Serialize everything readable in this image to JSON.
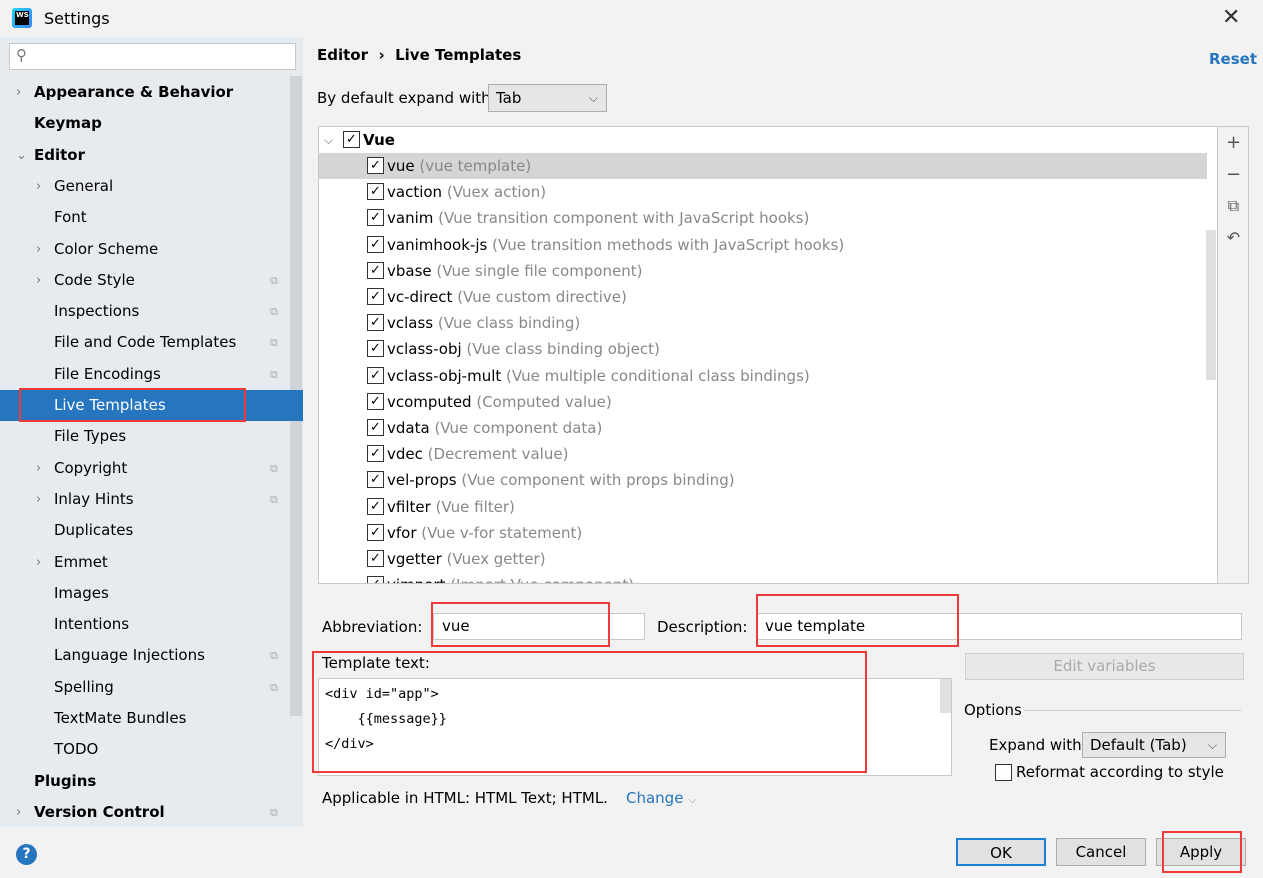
{
  "window": {
    "title": "Settings",
    "close": "✕",
    "logo_text": "WS"
  },
  "search": {
    "placeholder": "",
    "icon": "search-icon"
  },
  "sidebar": {
    "items": [
      {
        "label": "Appearance & Behavior",
        "level": 0,
        "bold": true,
        "arrow": "›",
        "copy": false
      },
      {
        "label": "Keymap",
        "level": 0,
        "bold": true,
        "arrow": "",
        "copy": false
      },
      {
        "label": "Editor",
        "level": 0,
        "bold": true,
        "arrow": "⌄",
        "copy": false
      },
      {
        "label": "General",
        "level": 1,
        "arrow": "›",
        "copy": false
      },
      {
        "label": "Font",
        "level": 1,
        "arrow": "",
        "copy": false
      },
      {
        "label": "Color Scheme",
        "level": 1,
        "arrow": "›",
        "copy": false
      },
      {
        "label": "Code Style",
        "level": 1,
        "arrow": "›",
        "copy": true
      },
      {
        "label": "Inspections",
        "level": 1,
        "arrow": "",
        "copy": true
      },
      {
        "label": "File and Code Templates",
        "level": 1,
        "arrow": "",
        "copy": true
      },
      {
        "label": "File Encodings",
        "level": 1,
        "arrow": "",
        "copy": true
      },
      {
        "label": "Live Templates",
        "level": 1,
        "arrow": "",
        "copy": false,
        "selected": true
      },
      {
        "label": "File Types",
        "level": 1,
        "arrow": "",
        "copy": false
      },
      {
        "label": "Copyright",
        "level": 1,
        "arrow": "›",
        "copy": true
      },
      {
        "label": "Inlay Hints",
        "level": 1,
        "arrow": "›",
        "copy": true
      },
      {
        "label": "Duplicates",
        "level": 1,
        "arrow": "",
        "copy": false
      },
      {
        "label": "Emmet",
        "level": 1,
        "arrow": "›",
        "copy": false
      },
      {
        "label": "Images",
        "level": 1,
        "arrow": "",
        "copy": false
      },
      {
        "label": "Intentions",
        "level": 1,
        "arrow": "",
        "copy": false
      },
      {
        "label": "Language Injections",
        "level": 1,
        "arrow": "",
        "copy": true
      },
      {
        "label": "Spelling",
        "level": 1,
        "arrow": "",
        "copy": true
      },
      {
        "label": "TextMate Bundles",
        "level": 1,
        "arrow": "",
        "copy": false
      },
      {
        "label": "TODO",
        "level": 1,
        "arrow": "",
        "copy": false
      },
      {
        "label": "Plugins",
        "level": 0,
        "bold": true,
        "arrow": "",
        "copy": false
      },
      {
        "label": "Version Control",
        "level": 0,
        "bold": true,
        "arrow": "›",
        "copy": true
      }
    ]
  },
  "header": {
    "breadcrumb_parent": "Editor",
    "breadcrumb_sep": "›",
    "breadcrumb_current": "Live Templates",
    "reset": "Reset"
  },
  "expand_default": {
    "label": "By default expand with",
    "value": "Tab"
  },
  "templates": {
    "group": "Vue",
    "group_checked": true,
    "selected_index": 0,
    "items": [
      {
        "name": "vue",
        "desc": "(vue template)",
        "checked": true
      },
      {
        "name": "vaction",
        "desc": "(Vuex action)",
        "checked": true
      },
      {
        "name": "vanim",
        "desc": "(Vue transition component with JavaScript hooks)",
        "checked": true
      },
      {
        "name": "vanimhook-js",
        "desc": "(Vue transition methods with JavaScript hooks)",
        "checked": true
      },
      {
        "name": "vbase",
        "desc": "(Vue single file component)",
        "checked": true
      },
      {
        "name": "vc-direct",
        "desc": "(Vue custom directive)",
        "checked": true
      },
      {
        "name": "vclass",
        "desc": "(Vue class binding)",
        "checked": true
      },
      {
        "name": "vclass-obj",
        "desc": "(Vue class binding object)",
        "checked": true
      },
      {
        "name": "vclass-obj-mult",
        "desc": "(Vue multiple conditional class bindings)",
        "checked": true
      },
      {
        "name": "vcomputed",
        "desc": "(Computed value)",
        "checked": true
      },
      {
        "name": "vdata",
        "desc": "(Vue component data)",
        "checked": true
      },
      {
        "name": "vdec",
        "desc": "(Decrement value)",
        "checked": true
      },
      {
        "name": "vel-props",
        "desc": "(Vue component with props binding)",
        "checked": true
      },
      {
        "name": "vfilter",
        "desc": "(Vue filter)",
        "checked": true
      },
      {
        "name": "vfor",
        "desc": "(Vue v-for statement)",
        "checked": true
      },
      {
        "name": "vgetter",
        "desc": "(Vuex getter)",
        "checked": true
      },
      {
        "name": "vimport",
        "desc": "(Import Vue component)",
        "checked": true
      }
    ]
  },
  "tools": {
    "add": "+",
    "remove": "−",
    "copy": "⧉",
    "revert": "↶"
  },
  "editor": {
    "abbreviation_label": "Abbreviation:",
    "abbreviation_value": "vue",
    "description_label": "Description:",
    "description_value": "vue template",
    "template_label": "Template text:",
    "template_lines": [
      "<div id=\"app\">",
      "    {{message}}",
      "</div>"
    ],
    "edit_variables": "Edit variables",
    "options_label": "Options",
    "expand_with_label": "Expand with",
    "expand_with_value": "Default (Tab)",
    "reformat_label": "Reformat according to style",
    "reformat_checked": false,
    "applicable": "Applicable in HTML: HTML Text; HTML.",
    "change": "Change"
  },
  "footer": {
    "help": "?",
    "ok": "OK",
    "cancel": "Cancel",
    "apply": "Apply"
  },
  "colors": {
    "accent": "#2675bf",
    "highlight_box": "#f03a3a",
    "sidebar_bg": "#e6ebf0"
  }
}
